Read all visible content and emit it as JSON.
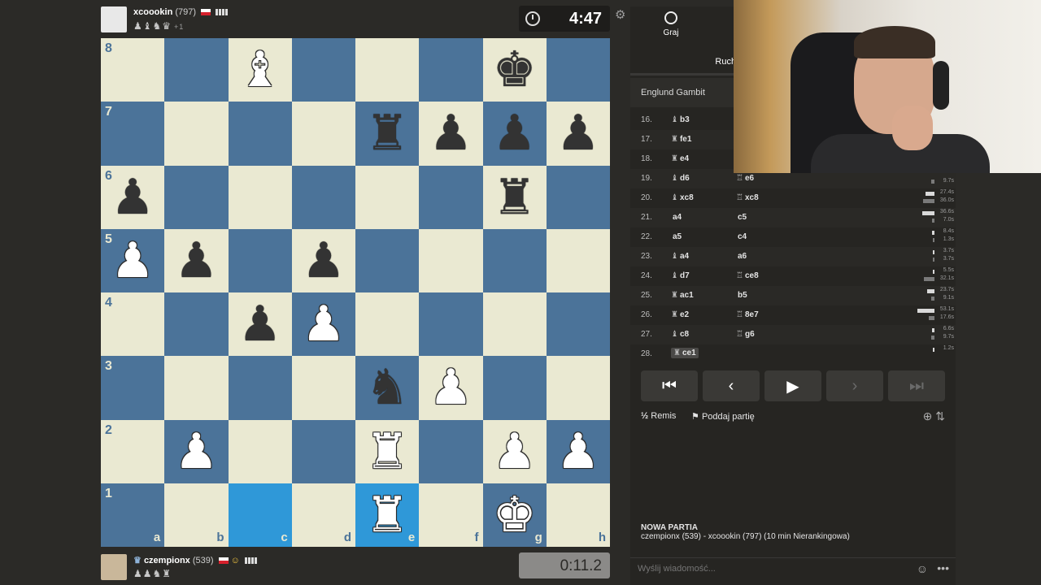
{
  "top_player": {
    "name": "xcoookin",
    "rating": "(797)",
    "captured": "♟♝♞♛",
    "captured_extra": "+1",
    "clock": "4:47"
  },
  "bottom_player": {
    "name": "czempionx",
    "rating": "(539)",
    "captured": "♟♟♞♜",
    "clock": "0:11.2"
  },
  "board": {
    "files": [
      "a",
      "b",
      "c",
      "d",
      "e",
      "f",
      "g",
      "h"
    ],
    "ranks": [
      "8",
      "7",
      "6",
      "5",
      "4",
      "3",
      "2",
      "1"
    ],
    "pieces": {
      "c8": {
        "g": "♝",
        "c": "white"
      },
      "g8": {
        "g": "♚",
        "c": "black"
      },
      "e7": {
        "g": "♜",
        "c": "black"
      },
      "f7": {
        "g": "♟",
        "c": "black"
      },
      "g7": {
        "g": "♟",
        "c": "black"
      },
      "h7": {
        "g": "♟",
        "c": "black"
      },
      "a6": {
        "g": "♟",
        "c": "black"
      },
      "g6": {
        "g": "♜",
        "c": "black"
      },
      "a5": {
        "g": "♟",
        "c": "white"
      },
      "b5": {
        "g": "♟",
        "c": "black"
      },
      "d5": {
        "g": "♟",
        "c": "black"
      },
      "c4": {
        "g": "♟",
        "c": "black"
      },
      "d4": {
        "g": "♟",
        "c": "white"
      },
      "e3": {
        "g": "♞",
        "c": "black"
      },
      "f3": {
        "g": "♟",
        "c": "white"
      },
      "b2": {
        "g": "♟",
        "c": "white"
      },
      "e2": {
        "g": "♜",
        "c": "white"
      },
      "g2": {
        "g": "♟",
        "c": "white"
      },
      "h2": {
        "g": "♟",
        "c": "white"
      },
      "e1": {
        "g": "♜",
        "c": "white"
      },
      "g1": {
        "g": "♚",
        "c": "white"
      }
    },
    "highlighted": [
      "c1",
      "e1"
    ]
  },
  "panel": {
    "tab_play": "Graj",
    "tab_moves": "Ruchy",
    "opening": "Englund Gambit",
    "moves": [
      {
        "n": "16.",
        "w": "b3",
        "wp": "♝",
        "b": "",
        "bp": "",
        "wt": "",
        "bt": ""
      },
      {
        "n": "17.",
        "w": "fe1",
        "wp": "♜",
        "b": "",
        "bp": "",
        "wt": "",
        "bt": ""
      },
      {
        "n": "18.",
        "w": "e4",
        "wp": "♜",
        "b": "",
        "bp": "",
        "wt": "",
        "bt": ""
      },
      {
        "n": "19.",
        "w": "d6",
        "wp": "♝",
        "b": "e6",
        "bp": "♖",
        "wt": "",
        "bt": "9.7s"
      },
      {
        "n": "20.",
        "w": "xc8",
        "wp": "♝",
        "b": "xc8",
        "bp": "♖",
        "wt": "27.4s",
        "bt": "36.0s"
      },
      {
        "n": "21.",
        "w": "a4",
        "wp": "",
        "b": "c5",
        "bp": "",
        "wt": "36.6s",
        "bt": "7.0s"
      },
      {
        "n": "22.",
        "w": "a5",
        "wp": "",
        "b": "c4",
        "bp": "",
        "wt": "8.4s",
        "bt": "1.3s"
      },
      {
        "n": "23.",
        "w": "a4",
        "wp": "♝",
        "b": "a6",
        "bp": "",
        "wt": "3.7s",
        "bt": "3.7s"
      },
      {
        "n": "24.",
        "w": "d7",
        "wp": "♝",
        "b": "ce8",
        "bp": "♖",
        "wt": "5.5s",
        "bt": "32.1s"
      },
      {
        "n": "25.",
        "w": "ac1",
        "wp": "♜",
        "b": "b5",
        "bp": "",
        "wt": "23.7s",
        "bt": "9.1s"
      },
      {
        "n": "26.",
        "w": "e2",
        "wp": "♜",
        "b": "8e7",
        "bp": "♖",
        "wt": "53.1s",
        "bt": "17.6s"
      },
      {
        "n": "27.",
        "w": "c8",
        "wp": "♝",
        "b": "g6",
        "bp": "♖",
        "wt": "6.6s",
        "bt": "9.7s"
      },
      {
        "n": "28.",
        "w": "ce1",
        "wp": "♜",
        "b": "",
        "bp": "",
        "wt": "1.2s",
        "bt": ""
      }
    ],
    "draw_label": "Remis",
    "resign_label": "Poddaj partię",
    "new_game_title": "NOWA PARTIA",
    "new_game_desc": "czempionx (539) - xcoookin (797) (10 min Nierankingowa)",
    "chat_placeholder": "Wyślij wiadomość..."
  }
}
